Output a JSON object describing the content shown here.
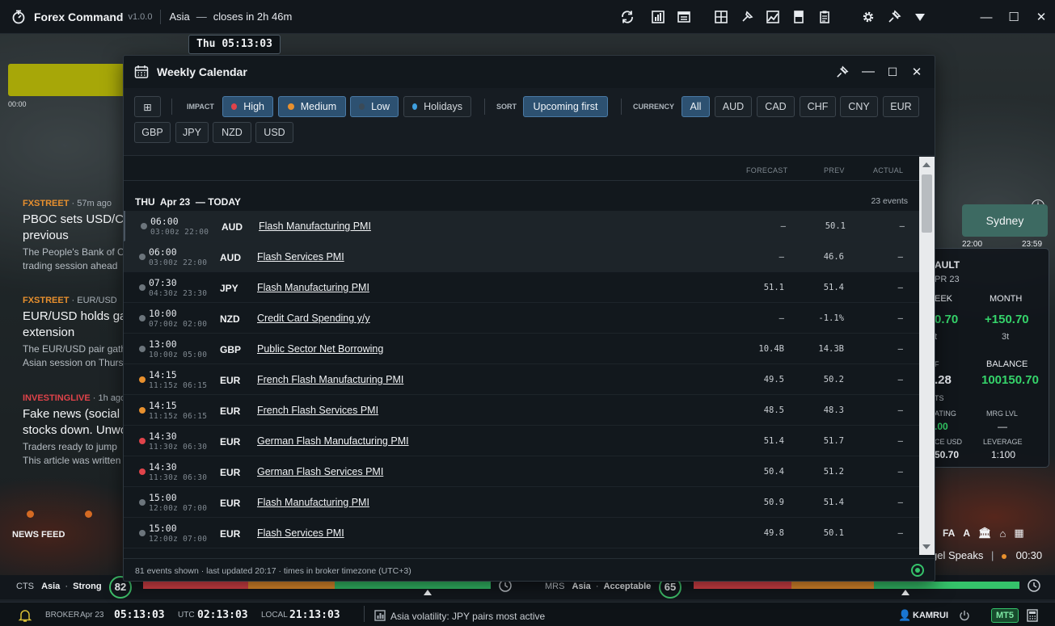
{
  "app": {
    "title": "Forex Command",
    "version": "v1.0.0",
    "session": "Asia",
    "session_dash": "—",
    "session_close": "closes in 2h 46m",
    "clock_chip": "Thu 05:13:03",
    "toolbar_icons": [
      "sync-icon",
      "bar-chart-icon",
      "news-icon",
      "grid-icon",
      "pin-tool-icon",
      "image-chart-icon",
      "book-icon",
      "clipboard-icon",
      "gear-icon",
      "pin-icon",
      "dropdown-icon"
    ],
    "colors": {
      "accent": "#2d5171",
      "high": "#e0434a",
      "medium": "#e8902e",
      "low": "#3a4a57",
      "holidays": "#3fa0e0",
      "positive": "#35d36a"
    }
  },
  "left_panel": {
    "bar_time": "00:00",
    "news": [
      {
        "source": "FXSTREET",
        "ago": " · 57m ago",
        "headline1": "PBOC sets USD/CNY",
        "headline2": "previous",
        "body1": "The People's Bank of China",
        "body2": "trading session ahead"
      },
      {
        "source": "FXSTREET",
        "ago": " · EUR/USD",
        "headline1": "EUR/USD holds gains",
        "headline2": "extension",
        "body1": "The EUR/USD pair gathers",
        "body2": "Asian session on Thursday"
      },
      {
        "source": "INVESTINGLIVE",
        "ago": " · 1h ago",
        "headline1": "Fake news (social media)",
        "headline2": "stocks down. Unwound",
        "body1": "Traders ready to jump",
        "body2": "This article was written"
      }
    ],
    "news_feed_label": "NEWS FEED"
  },
  "right_panel": {
    "sydney": "Sydney",
    "sydney_start": "22:00",
    "sydney_end": "23:59",
    "account_title": "AULT",
    "account_date": "PR 23",
    "week_label": "EEK",
    "month_label": "MONTH",
    "week_value": "0.70",
    "month_value": "+150.70",
    "week_trades": "t",
    "month_trades": "3t",
    "pf_label": "F",
    "balance_label": "BALANCE",
    "pf_value": ".28",
    "balance_value": "100150.70",
    "ts_label": "TS",
    "rating_label": "ATING",
    "mrg_label": "MRG LVL",
    "rating_value": ".00",
    "mrg_value": "—",
    "bal_usd_label": "CE USD",
    "leverage_label": "LEVERAGE",
    "bal_usd_value": "50.70",
    "leverage_value": "1:100",
    "fa_label": "FA",
    "a_label": "A",
    "event_text": "gel Speaks",
    "event_sep": "|",
    "event_time": "00:30"
  },
  "meters": {
    "cts_label": "CTS",
    "cts_session": "Asia",
    "cts_state": "Strong",
    "cts_score": "82",
    "mrs_label": "MRS",
    "mrs_session": "Asia",
    "mrs_state": "Acceptable",
    "mrs_score": "65"
  },
  "statusbar": {
    "broker_label": "BROKER",
    "broker_date": "Apr 23",
    "broker_time": "05:13:03",
    "utc_label": "UTC",
    "utc_time": "02:13:03",
    "local_label": "LOCAL",
    "local_time": "21:13:03",
    "message": "Asia volatility: JPY pairs most active",
    "user": "KAMRUI",
    "platform": "MT5"
  },
  "calendar": {
    "title": "Weekly Calendar",
    "filters": {
      "grid_toggle": "⊞",
      "impact_label": "IMPACT",
      "impact": [
        {
          "label": "High",
          "active": true
        },
        {
          "label": "Medium",
          "active": true
        },
        {
          "label": "Low",
          "active": true
        },
        {
          "label": "Holidays",
          "active": false
        }
      ],
      "sort_label": "SORT",
      "sort_value": "Upcoming first",
      "currency_label": "CURRENCY",
      "currencies": [
        "All",
        "AUD",
        "CAD",
        "CHF",
        "CNY",
        "EUR",
        "GBP",
        "JPY",
        "NZD",
        "USD"
      ],
      "selected_currency": "All"
    },
    "columns": {
      "forecast": "FORECAST",
      "prev": "PREV",
      "actual": "ACTUAL"
    },
    "day": {
      "label": "THU  Apr 23  — TODAY",
      "count": "23 events"
    },
    "rows": [
      {
        "time": "06:00",
        "sub": "03:00z 22:00",
        "ccy": "AUD",
        "name": "Flash Manufacturing PMI",
        "forecast": "–",
        "prev": "50.1",
        "actual": "–",
        "impact": "low"
      },
      {
        "time": "06:00",
        "sub": "03:00z 22:00",
        "ccy": "AUD",
        "name": "Flash Services PMI",
        "forecast": "–",
        "prev": "46.6",
        "actual": "–",
        "impact": "low"
      },
      {
        "time": "07:30",
        "sub": "04:30z 23:30",
        "ccy": "JPY",
        "name": "Flash Manufacturing PMI",
        "forecast": "51.1",
        "prev": "51.4",
        "actual": "–",
        "impact": "low"
      },
      {
        "time": "10:00",
        "sub": "07:00z 02:00",
        "ccy": "NZD",
        "name": "Credit Card Spending y/y",
        "forecast": "–",
        "prev": "-1.1%",
        "actual": "–",
        "impact": "low"
      },
      {
        "time": "13:00",
        "sub": "10:00z 05:00",
        "ccy": "GBP",
        "name": "Public Sector Net Borrowing",
        "forecast": "10.4B",
        "prev": "14.3B",
        "actual": "–",
        "impact": "low"
      },
      {
        "time": "14:15",
        "sub": "11:15z 06:15",
        "ccy": "EUR",
        "name": "French Flash Manufacturing PMI",
        "forecast": "49.5",
        "prev": "50.2",
        "actual": "–",
        "impact": "medium"
      },
      {
        "time": "14:15",
        "sub": "11:15z 06:15",
        "ccy": "EUR",
        "name": "French Flash Services PMI",
        "forecast": "48.5",
        "prev": "48.3",
        "actual": "–",
        "impact": "medium"
      },
      {
        "time": "14:30",
        "sub": "11:30z 06:30",
        "ccy": "EUR",
        "name": "German Flash Manufacturing PMI",
        "forecast": "51.4",
        "prev": "51.7",
        "actual": "–",
        "impact": "high"
      },
      {
        "time": "14:30",
        "sub": "11:30z 06:30",
        "ccy": "EUR",
        "name": "German Flash Services PMI",
        "forecast": "50.4",
        "prev": "51.2",
        "actual": "–",
        "impact": "high"
      },
      {
        "time": "15:00",
        "sub": "12:00z 07:00",
        "ccy": "EUR",
        "name": "Flash Manufacturing PMI",
        "forecast": "50.9",
        "prev": "51.4",
        "actual": "–",
        "impact": "low"
      },
      {
        "time": "15:00",
        "sub": "12:00z 07:00",
        "ccy": "EUR",
        "name": "Flash Services PMI",
        "forecast": "49.8",
        "prev": "50.1",
        "actual": "–",
        "impact": "low"
      }
    ],
    "footer": "81 events shown · last updated 20:17 · times in broker timezone (UTC+3)"
  }
}
